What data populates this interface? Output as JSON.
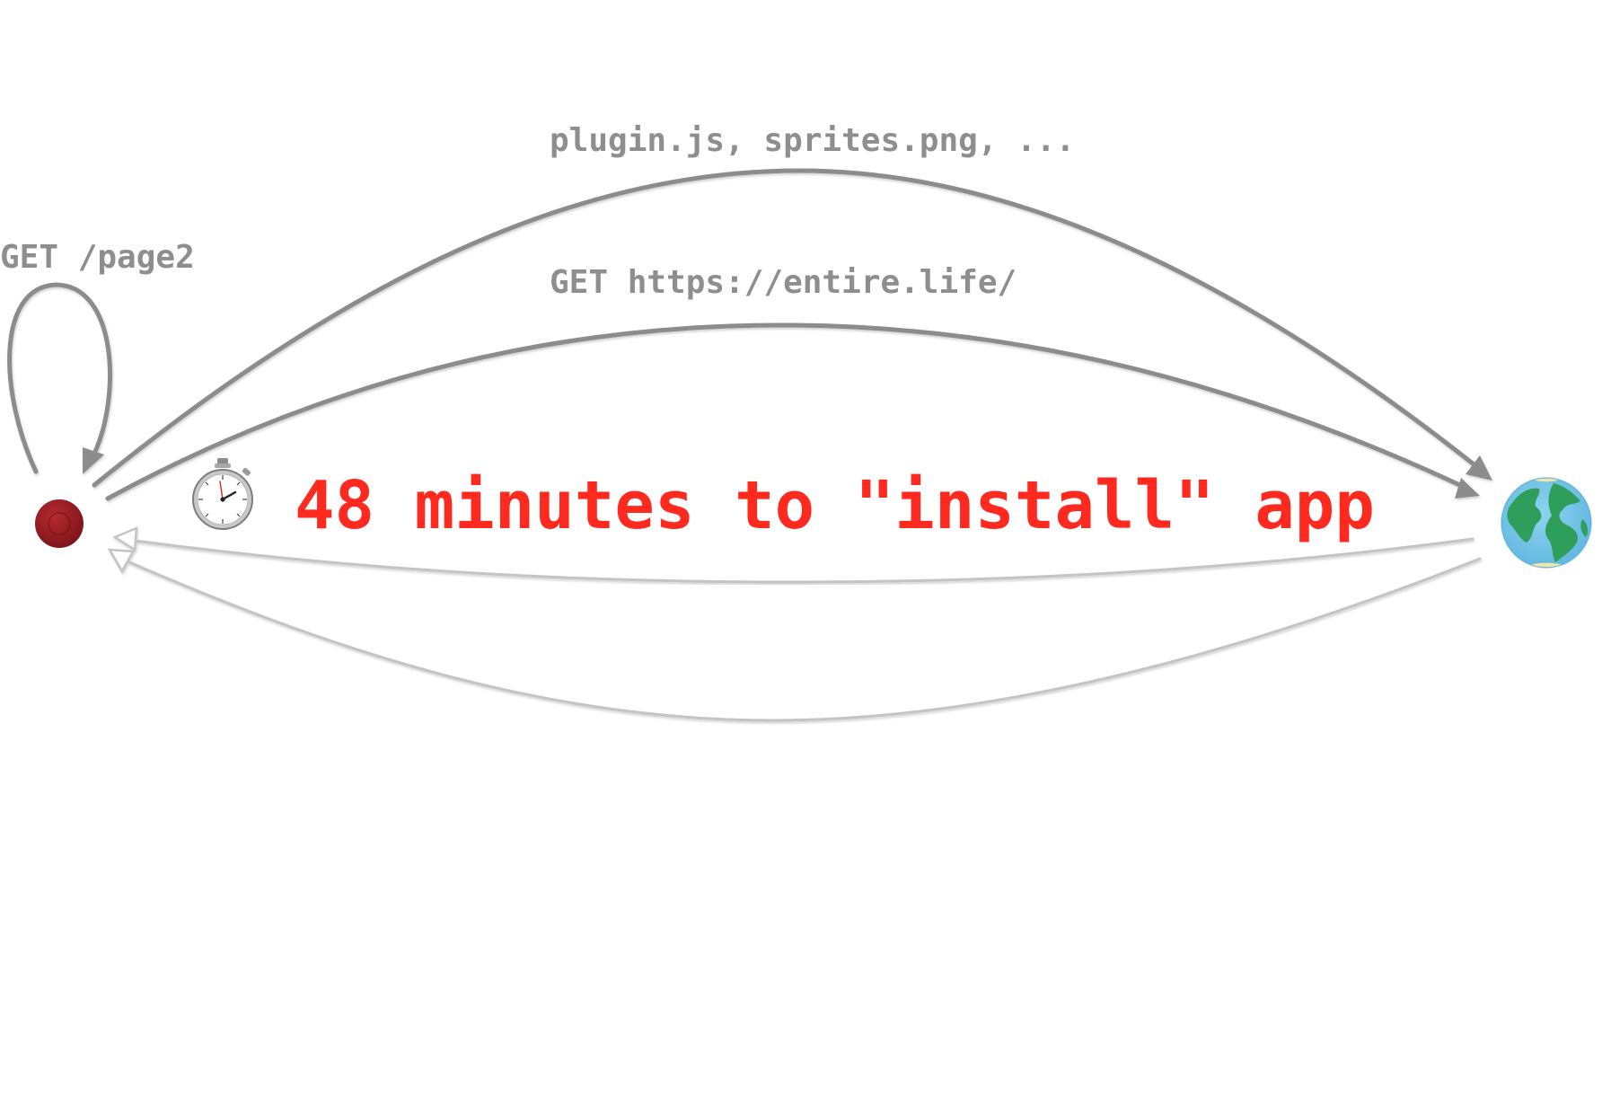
{
  "labels": {
    "self_request": "GET /page2",
    "assets_request": "plugin.js, sprites.png, ...",
    "page_request": "GET https://entire.life/"
  },
  "headline": {
    "icon": "stopwatch-icon",
    "text": "48 minutes to \"install\" app",
    "color": "#ff2a1f"
  },
  "nodes": {
    "client": {
      "icon": "red-dot-icon",
      "color": "#8b1a1f"
    },
    "server": {
      "icon": "globe-icon",
      "ocean_color": "#7ec8e8",
      "land_color": "#2e9e5b"
    }
  },
  "colors": {
    "request_arrow": "#8c8c8c",
    "response_arrow": "#c4c4c4",
    "label_text": "#8e8e8e"
  }
}
